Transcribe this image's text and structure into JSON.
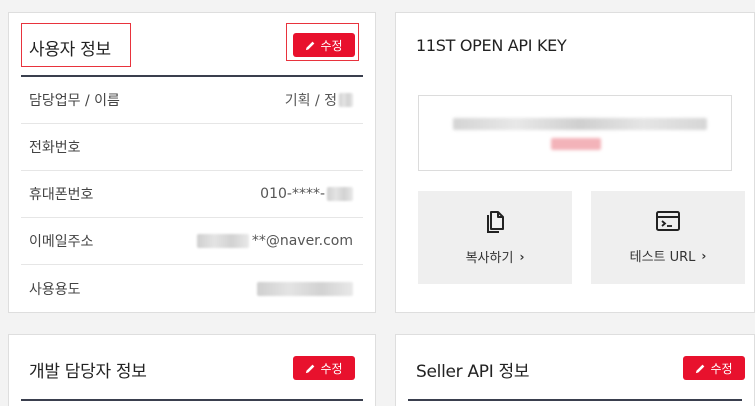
{
  "user_info": {
    "title": "사용자 정보",
    "edit_label": "수정",
    "rows": [
      {
        "label": "담당업무 / 이름",
        "value": "기획 / 정"
      },
      {
        "label": "전화번호",
        "value": ""
      },
      {
        "label": "휴대폰번호",
        "value": "010-****-"
      },
      {
        "label": "이메일주소",
        "value": "**@naver.com"
      },
      {
        "label": "사용용도",
        "value": ""
      }
    ]
  },
  "api_key": {
    "title": "11ST OPEN API KEY",
    "copy_label": "복사하기",
    "test_label": "테스트 URL"
  },
  "dev_info": {
    "title": "개발 담당자 정보",
    "edit_label": "수정"
  },
  "seller_api": {
    "title": "Seller API 정보",
    "edit_label": "수정"
  },
  "colors": {
    "accent": "#e8112d",
    "highlight": "#e8333d",
    "divider": "#3a3f4e"
  },
  "icons": {
    "edit": "pencil-icon",
    "copy": "copy-documents-icon",
    "test": "terminal-window-icon",
    "chevron": "chevron-right-icon"
  }
}
